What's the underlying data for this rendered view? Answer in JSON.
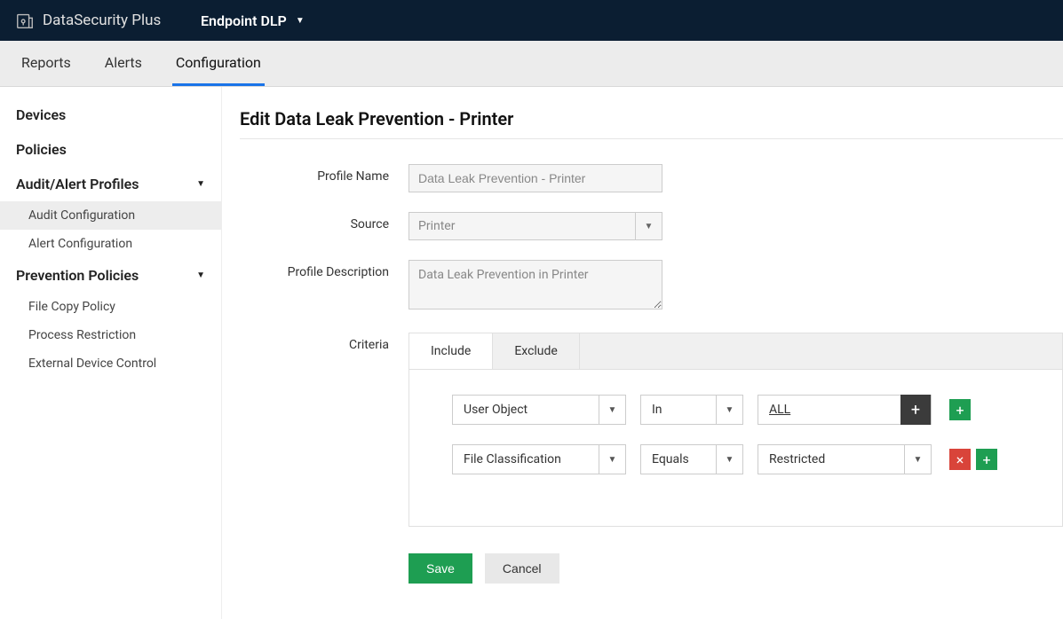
{
  "topbar": {
    "product": "DataSecurity Plus",
    "module": "Endpoint DLP"
  },
  "subnav": {
    "tabs": [
      "Reports",
      "Alerts",
      "Configuration"
    ],
    "active": 2
  },
  "sidebar": {
    "items": [
      {
        "label": "Devices",
        "type": "section"
      },
      {
        "label": "Policies",
        "type": "section"
      },
      {
        "label": "Audit/Alert Profiles",
        "type": "section",
        "expandable": true
      },
      {
        "label": "Audit Configuration",
        "type": "sub",
        "active": true
      },
      {
        "label": "Alert Configuration",
        "type": "sub"
      },
      {
        "label": "Prevention Policies",
        "type": "section",
        "expandable": true
      },
      {
        "label": "File Copy Policy",
        "type": "sub"
      },
      {
        "label": "Process Restriction",
        "type": "sub"
      },
      {
        "label": "External Device Control",
        "type": "sub"
      }
    ]
  },
  "page": {
    "title": "Edit Data Leak Prevention - Printer",
    "fields": {
      "profile_name_label": "Profile Name",
      "profile_name_value": "Data Leak Prevention - Printer",
      "source_label": "Source",
      "source_value": "Printer",
      "desc_label": "Profile Description",
      "desc_value": "Data Leak Prevention in Printer",
      "criteria_label": "Criteria"
    },
    "criteria_tabs": {
      "include": "Include",
      "exclude": "Exclude"
    },
    "criteria_rows": [
      {
        "col1": "User Object",
        "col2": "In",
        "col3": "ALL",
        "col3_type": "valuebox"
      },
      {
        "col1": "File Classification",
        "col2": "Equals",
        "col3": "Restricted",
        "col3_type": "select"
      }
    ],
    "buttons": {
      "save": "Save",
      "cancel": "Cancel"
    }
  }
}
